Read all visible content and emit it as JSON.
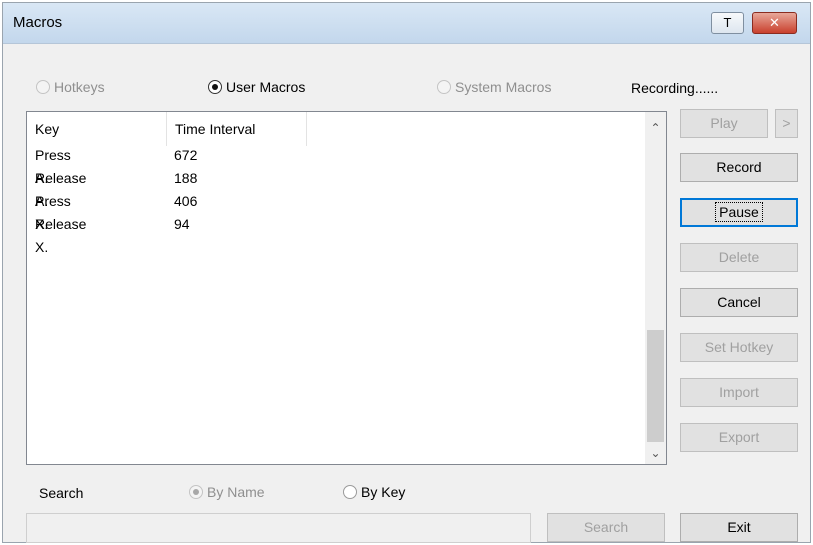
{
  "window": {
    "title": "Macros",
    "topmost_button_label": "T",
    "close_button_label": "✕"
  },
  "mode": {
    "hotkeys": "Hotkeys",
    "user_macros": "User Macros",
    "system_macros": "System Macros",
    "selected": "user_macros"
  },
  "status": "Recording......",
  "list": {
    "columns": [
      "Key",
      "Time Interval"
    ],
    "rows": [
      {
        "key": "Press A.",
        "time": "672"
      },
      {
        "key": "Release A.",
        "time": "188"
      },
      {
        "key": "Press X.",
        "time": "406"
      },
      {
        "key": "Release X.",
        "time": "94"
      }
    ]
  },
  "buttons": {
    "play": "Play",
    "play_more": ">",
    "record": "Record",
    "pause": "Pause",
    "delete": "Delete",
    "cancel": "Cancel",
    "set_hotkey": "Set Hotkey",
    "import": "Import",
    "export": "Export",
    "exit": "Exit"
  },
  "search": {
    "label": "Search",
    "by_name": "By Name",
    "by_key": "By Key",
    "input_value": "",
    "button": "Search"
  }
}
